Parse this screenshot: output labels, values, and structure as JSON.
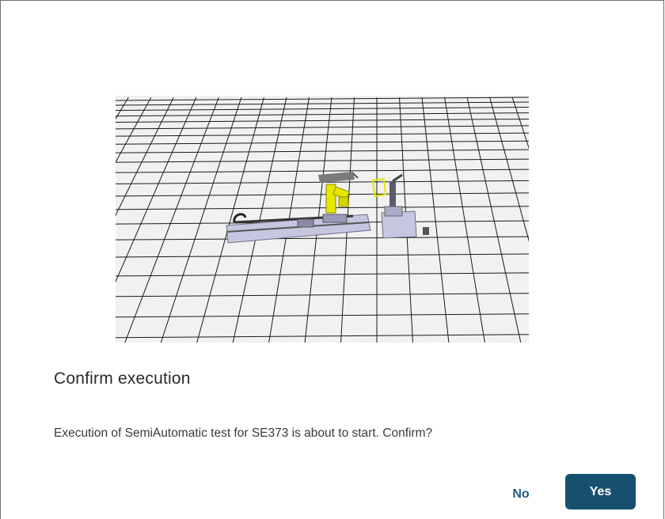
{
  "dialog": {
    "title": "Confirm execution",
    "message": "Execution of SemiAutomatic test for SE373 is about to start. Confirm?",
    "no_label": "No",
    "yes_label": "Yes"
  },
  "preview": {
    "description_icon": "3d-scene-preview",
    "grid_color": "#1a1a1a",
    "floor_color": "#f1f1f1",
    "highlight_color": "#e6e600",
    "machine_color": "#b9b9d9"
  },
  "colors": {
    "accent": "#17506f",
    "link": "#1e5b82"
  }
}
